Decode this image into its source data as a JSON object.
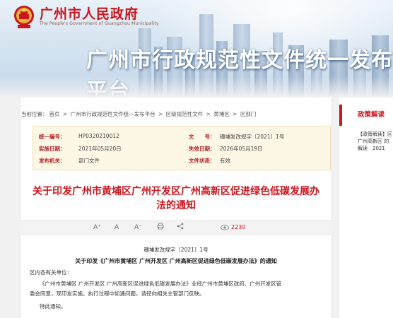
{
  "header": {
    "site_name": "广州市人民政府",
    "site_subtitle": "The People's Government of Guangzhou Municipality",
    "platform_title": "广州市行政规范性文件统一发布平台"
  },
  "breadcrumb": {
    "prefix": "当前位置：",
    "items": [
      "首页",
      "广州市行政规范性文件统一发布平台",
      "区级规范性文件",
      "黄埔区",
      "区部门"
    ],
    "separator": ">"
  },
  "meta": {
    "serial_label": "统一编号：",
    "serial_value": "HP0320210012",
    "doc_no_label": "文　　号：",
    "doc_no_value": "穗埔发改规字〔2021〕1号",
    "impl_label": "实施日期：",
    "impl_value": "2021年05月20日",
    "expiry_label": "失效日期：",
    "expiry_value": "2026年05月19日",
    "issuer_label": "发布机关：",
    "issuer_value": "部门文件",
    "status_label": "文件状态：",
    "status_value": "有效"
  },
  "document": {
    "title_line1": "关于印发广州市黄埔区广州开发区广州高新区促进绿色低碳发展办",
    "title_line2": "法的通知",
    "doc_number": "穗埔发改规字〔2021〕1号",
    "heading": "关于印发《广州市黄埔区 广州开发区 广州高新区促进绿色低碳发展办法》的通知",
    "salutation": "区内各有关单位：",
    "para1": "《广州市黄埔区 广州开发区 广州高新区促进绿色低碳发展办法》业经广州市黄埔区政府、广州开发区管",
    "para2": "委会同意，现印发实施。执行过程中如遇问题，请径向相关主管部门反映。",
    "closing": "特此通知。"
  },
  "toolbar": {
    "font_up": "A⁺",
    "font_normal": "A",
    "font_down": "A⁻",
    "print_icon": "print-icon",
    "share_icon": "share-icon",
    "views": "2230"
  },
  "sidebar": {
    "title": "政策解读",
    "item": "【政策解读】区 广州高新区 的解读　2021"
  },
  "colors": {
    "brand_red": "#c8171e",
    "meta_bg": "#fdf7e6"
  }
}
